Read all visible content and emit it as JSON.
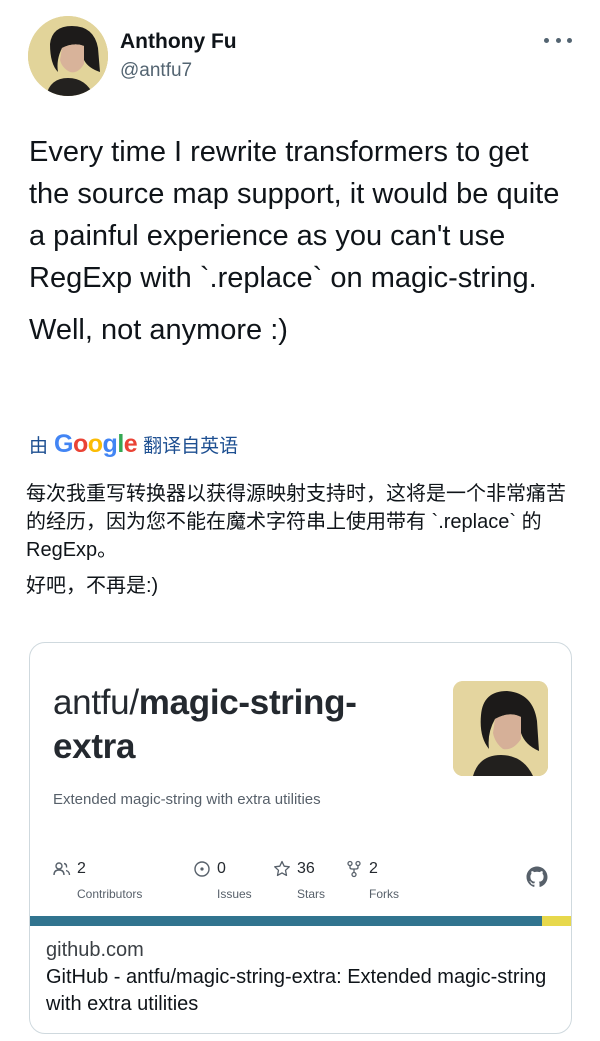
{
  "author": {
    "name": "Anthony Fu",
    "handle": "@antfu7"
  },
  "tweet": {
    "paragraph1": "Every time I rewrite transformers to get the source map support, it would be quite a painful experience as you can't use RegExp with `.replace` on magic-string.",
    "paragraph2": "Well, not anymore :)"
  },
  "translation": {
    "prefix": "由",
    "provider_letters": [
      "G",
      "o",
      "o",
      "g",
      "l",
      "e"
    ],
    "suffix": "翻译自英语",
    "paragraph1": "每次我重写转换器以获得源映射支持时，这将是一个非常痛苦的经历，因为您不能在魔术字符串上使用带有 `.replace` 的 RegExp。",
    "paragraph2": "好吧，不再是:)"
  },
  "card": {
    "repo_owner": "antfu/",
    "repo_name": "magic-string-extra",
    "description": "Extended magic-string with extra utilities",
    "stats": [
      {
        "icon": "contributors-icon",
        "value": "2",
        "label": "Contributors"
      },
      {
        "icon": "issues-icon",
        "value": "0",
        "label": "Issues"
      },
      {
        "icon": "star-icon",
        "value": "36",
        "label": "Stars"
      },
      {
        "icon": "fork-icon",
        "value": "2",
        "label": "Forks"
      }
    ],
    "domain": "github.com",
    "link_title": "GitHub - antfu/magic-string-extra: Extended magic-string with extra utilities"
  },
  "colors": {
    "text": "#0f1419",
    "secondary": "#536471",
    "translate_link": "#1d4f91",
    "lang_primary": "#31748f",
    "lang_secondary": "#e7d84c"
  }
}
